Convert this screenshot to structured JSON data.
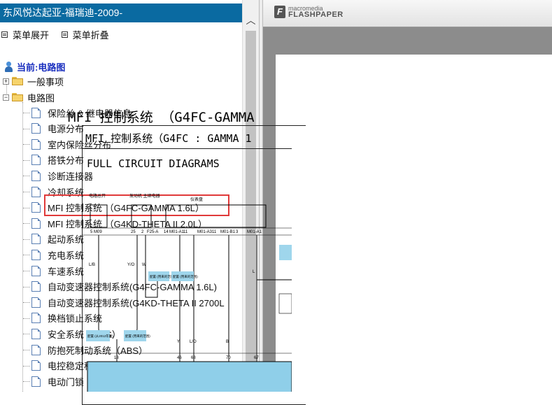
{
  "left_panel": {
    "title": "东风悦达起亚-福瑞迪-2009-",
    "menu": {
      "expand": "菜单展开",
      "collapse": "菜单折叠"
    },
    "current": "当前:电路图",
    "tree": {
      "general": "一般事项",
      "circuit": "电路图",
      "items": [
        "保险丝 & 继电器信息",
        "电源分布",
        "室内保险丝分布",
        "搭铁分布",
        "诊断连接器",
        "冷却系统",
        "MFI 控制系统 （G4FC-GAMMA 1.6L）",
        "MFI 控制系统 （G4KD-THETA II 2.0L）",
        "起动系统",
        "充电系统",
        "车速系统",
        "自动变速器控制系统(G4FC-GAMMA 1.6L)",
        "自动变速器控制系统(G4KD-THETA II 2700L",
        "换档锁止系统",
        "安全系统（SRS）",
        "防抱死制动系统（ABS）",
        "电控稳定程序（ESP）系统",
        "电动门锁"
      ],
      "selected_index": 6
    }
  },
  "viewer": {
    "logo_top": "macromedia",
    "logo_bottom": "FLASHPAPER",
    "doc_title": "MFI 控制系统 （G4FC-GAMMA",
    "frame_title": "MFI 控制系统（G4FC : GAMMA 1",
    "section": "FULL CIRCUIT DIAGRAMS",
    "diagram": {
      "box_labels": [
        "电路总开",
        "发动机 主继电器",
        "仪表盘"
      ],
      "pin_labels": [
        "5 M09",
        "25",
        "2",
        "F25-A",
        "14",
        "M01-A1",
        "11",
        "M01-A3",
        "11",
        "M01-B1",
        "3",
        "M01-A1"
      ],
      "wire_colors": [
        "L/B",
        "Y/O",
        "W",
        "Y",
        "L/O",
        "B",
        "L"
      ],
      "bottom_pins": [
        "18",
        "46",
        "68",
        "70",
        "67"
      ],
      "tags": [
        "配置 (用来的范围)",
        "配置 (用来的范围)",
        "配置 (从2012年起)",
        "配置 (用来的范围)"
      ]
    }
  }
}
